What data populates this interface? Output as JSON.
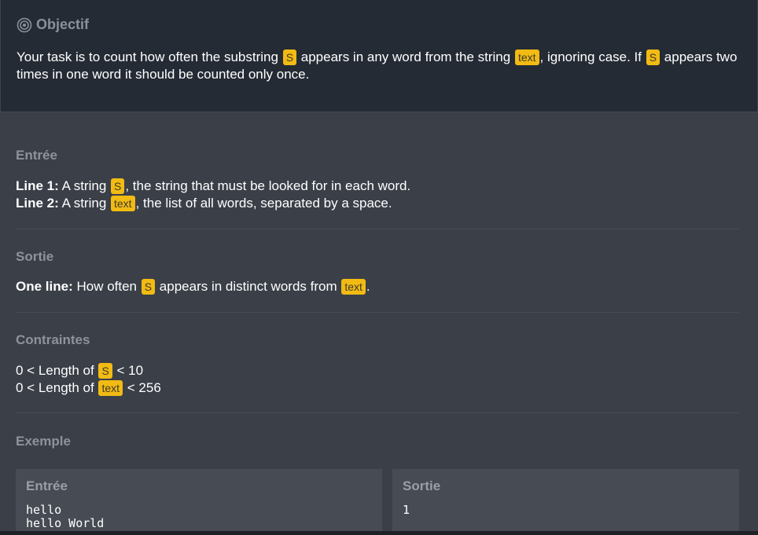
{
  "objective": {
    "title": "Objectif",
    "text_1": "Your task is to count how often the substring ",
    "s_1": "S",
    "text_2": " appears in any word from the string ",
    "text_var": "text",
    "text_3": ", ignoring case. If ",
    "s_2": "S",
    "text_4": " appears two times in one word it should be counted only once."
  },
  "input": {
    "title": "Entrée",
    "line1_label": "Line 1:",
    "line1_pre": " A string ",
    "line1_var": "S",
    "line1_post": ", the string that must be looked for in each word.",
    "line2_label": "Line 2:",
    "line2_pre": " A string ",
    "line2_var": "text",
    "line2_post": ", the list of all words, separated by a space."
  },
  "output": {
    "title": "Sortie",
    "label": "One line:",
    "pre": " How often ",
    "var1": "S",
    "mid": " appears in distinct words from ",
    "var2": "text",
    "post": "."
  },
  "constraints": {
    "title": "Contraintes",
    "c1_pre": "0 < Length of ",
    "c1_var": "S",
    "c1_post": " < 10",
    "c2_pre": "0 < Length of ",
    "c2_var": "text",
    "c2_post": " < 256"
  },
  "example": {
    "title": "Exemple",
    "input_title": "Entrée",
    "input_line1": "hello",
    "input_line2": "hello World",
    "output_title": "Sortie",
    "output_value": "1"
  },
  "colors": {
    "highlight": "#f2bb13",
    "panel": "#252b35",
    "background": "#3a3f48"
  },
  "icons": {
    "objective": "target-icon"
  }
}
